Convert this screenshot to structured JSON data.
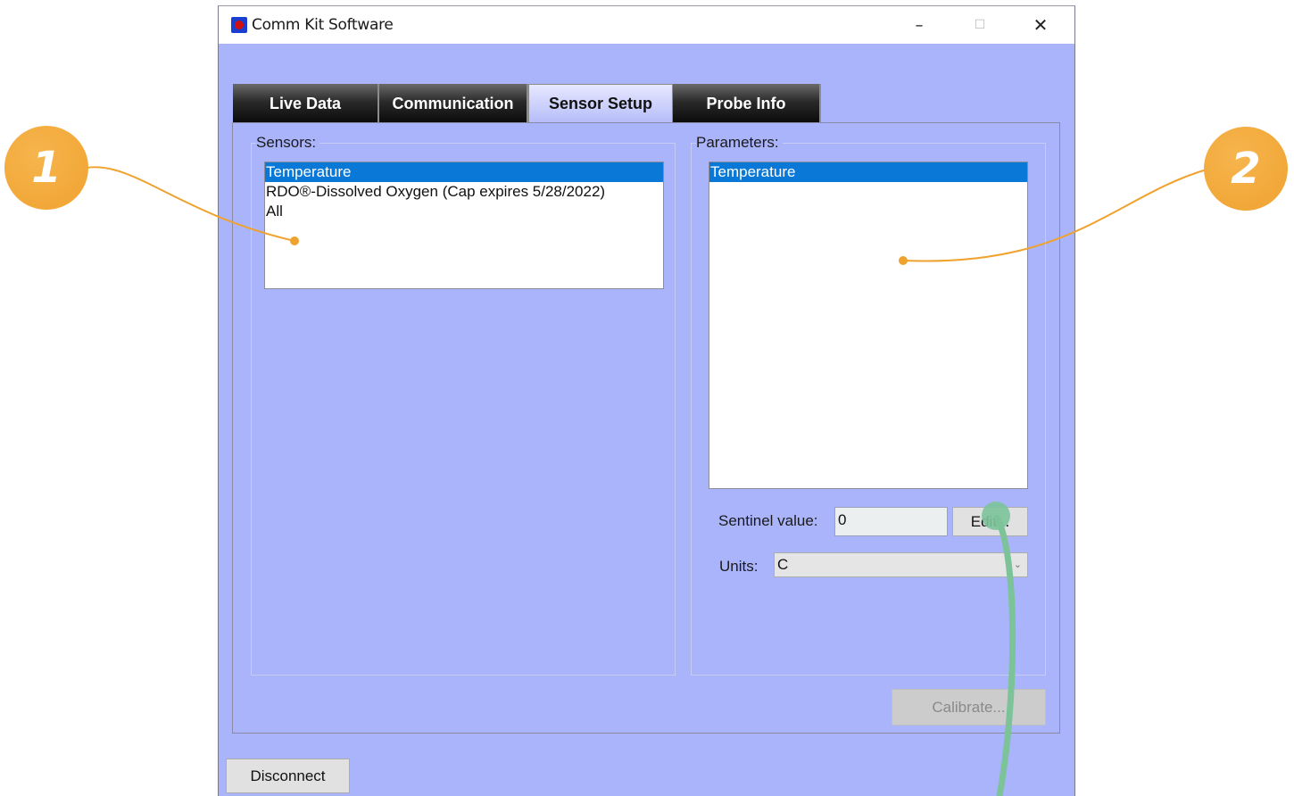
{
  "window": {
    "title": "Comm Kit Software",
    "controls": {
      "minimize": "–",
      "maximize": "☐",
      "close": "✕"
    }
  },
  "tabs": [
    {
      "label": "Live Data",
      "active": false
    },
    {
      "label": "Communication",
      "active": false
    },
    {
      "label": "Sensor Setup",
      "active": true
    },
    {
      "label": "Probe Info",
      "active": false
    }
  ],
  "sensors": {
    "label": "Sensors:",
    "items": [
      {
        "label": "Temperature",
        "selected": true
      },
      {
        "label": "RDO®-Dissolved Oxygen (Cap expires 5/28/2022)",
        "selected": false
      },
      {
        "label": "All",
        "selected": false
      }
    ]
  },
  "parameters": {
    "label": "Parameters:",
    "items": [
      {
        "label": "Temperature",
        "selected": true
      }
    ],
    "sentinel_label": "Sentinel value:",
    "sentinel_value": "0",
    "edit_button": "Edit...",
    "units_label": "Units:",
    "units_value": "C"
  },
  "calibrate_button": "Calibrate...",
  "disconnect_button": "Disconnect",
  "callouts": [
    "1",
    "2"
  ],
  "colors": {
    "window_bg": "#aab4fb",
    "selection": "#0a78d7",
    "callout_orange": "#f0a22f",
    "callout_green": "#7cc39a"
  }
}
